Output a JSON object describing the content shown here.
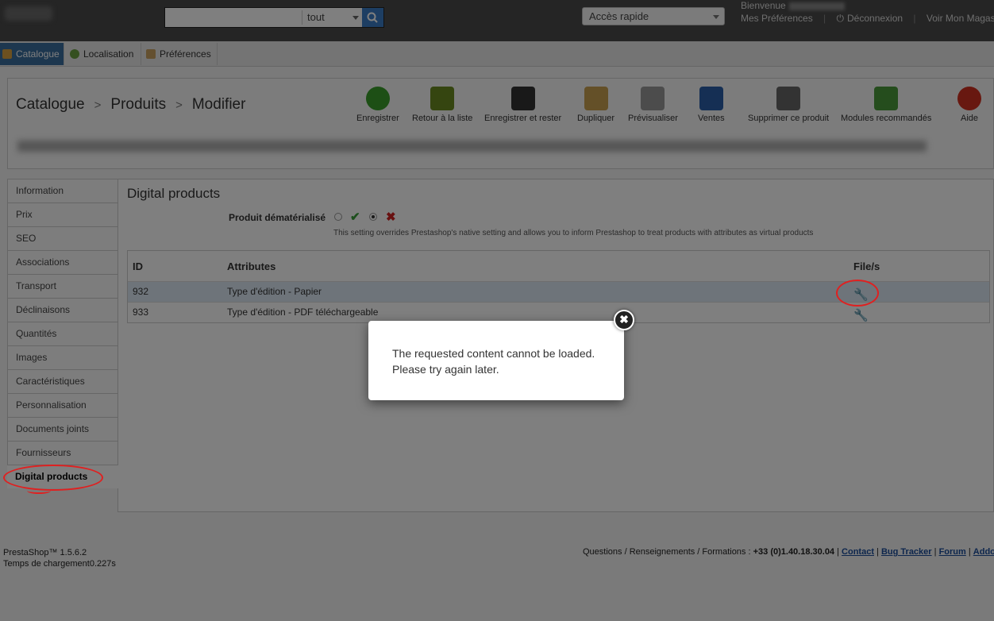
{
  "header": {
    "search": {
      "value": "",
      "scope": "tout"
    },
    "quick_access": "Accès rapide",
    "welcome": "Bienvenue",
    "links": [
      "Mes Préférences",
      "|",
      "Déconnexion",
      "|",
      "Voir Mon Magasin"
    ]
  },
  "tabs": [
    {
      "label": "Catalogue",
      "active": true
    },
    {
      "label": "Localisation",
      "active": false
    },
    {
      "label": "Préférences",
      "active": false
    }
  ],
  "breadcrumb": [
    "Catalogue",
    "Produits",
    "Modifier"
  ],
  "toolbar": [
    {
      "label": "Enregistrer",
      "icon": "check-circle-icon",
      "color": "#3a9e2a"
    },
    {
      "label": "Retour à la liste",
      "icon": "back-arrow-icon",
      "color": "#6a8a20"
    },
    {
      "label": "Enregistrer et rester",
      "icon": "floppy-disk-icon",
      "color": "#333333"
    },
    {
      "label": "Dupliquer",
      "icon": "duplicate-icon",
      "color": "#c9a050"
    },
    {
      "label": "Prévisualiser",
      "icon": "magnifier-icon",
      "color": "#999999"
    },
    {
      "label": "Ventes",
      "icon": "bar-chart-icon",
      "color": "#2a5fa8"
    },
    {
      "label": "Supprimer ce produit",
      "icon": "trash-icon",
      "color": "#666666"
    },
    {
      "label": "Modules recommandés",
      "icon": "puzzle-icon",
      "color": "#4a9a3a"
    },
    {
      "label": "Aide",
      "icon": "lifebuoy-icon",
      "color": "#d03020"
    }
  ],
  "left_nav": [
    {
      "label": "Information"
    },
    {
      "label": "Prix"
    },
    {
      "label": "SEO"
    },
    {
      "label": "Associations"
    },
    {
      "label": "Transport"
    },
    {
      "label": "Déclinaisons"
    },
    {
      "label": "Quantités"
    },
    {
      "label": "Images"
    },
    {
      "label": "Caractéristiques"
    },
    {
      "label": "Personnalisation"
    },
    {
      "label": "Documents joints"
    },
    {
      "label": "Fournisseurs"
    },
    {
      "label": "Digital products",
      "active": true
    }
  ],
  "content": {
    "title": "Digital products",
    "dematerialized_label": "Produit dématérialisé",
    "dematerialized_value": "no",
    "yes_symbol": "✔",
    "no_symbol": "✖",
    "note": "This setting overrides Prestashop's native setting and allows you to inform Prestashop to treat products with attributes as virtual products",
    "table": {
      "headers": [
        "ID",
        "Attributes",
        "File/s"
      ],
      "rows": [
        {
          "id": "932",
          "attributes": "Type d'édition - Papier",
          "highlight": true
        },
        {
          "id": "933",
          "attributes": "Type d'édition - PDF téléchargeable",
          "highlight": false
        }
      ]
    }
  },
  "modal": {
    "line1": "The requested content cannot be loaded.",
    "line2": "Please try again later.",
    "close_symbol": "✖"
  },
  "footer": {
    "version": "PrestaShop™ 1.5.6.2",
    "load_time": "Temps de chargement0.227s",
    "questions": "Questions / Renseignements / Formations : ",
    "phone": "+33 (0)1.40.18.30.04",
    "links": [
      "Contact",
      "Bug Tracker",
      "Forum",
      "Addons"
    ]
  },
  "colors": {
    "annotation": "#e02020",
    "active_tab": "#3a6e9e",
    "highlight_row": "#dce9f5"
  }
}
